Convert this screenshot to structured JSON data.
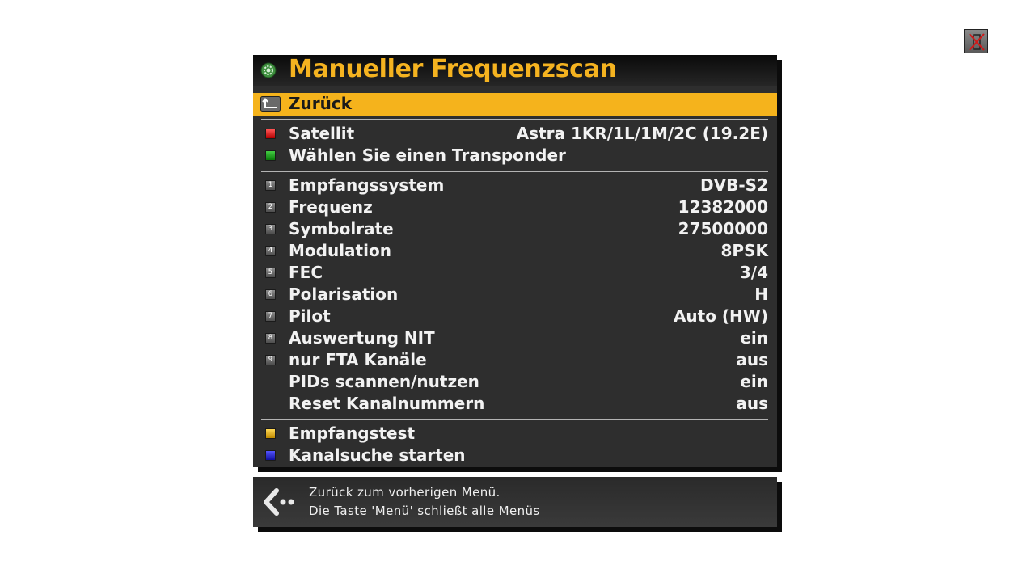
{
  "window": {
    "close_icon": "close-x-icon"
  },
  "menu": {
    "title": "Manueller Frequenzscan",
    "title_icon": "gear-icon",
    "title_color": "#f5b320",
    "highlight_color": "#f5b31c",
    "back": {
      "label": "Zurück",
      "icon": "back-arrow-icon",
      "selected": true
    },
    "section1": [
      {
        "key": "red",
        "label": "Satellit",
        "value": "Astra 1KR/1L/1M/2C (19.2E)"
      },
      {
        "key": "green",
        "label": "Wählen Sie einen Transponder",
        "value": ""
      }
    ],
    "section2": [
      {
        "key": "1",
        "label": "Empfangssystem",
        "value": "DVB-S2"
      },
      {
        "key": "2",
        "label": "Frequenz",
        "value": "12382000"
      },
      {
        "key": "3",
        "label": "Symbolrate",
        "value": "27500000"
      },
      {
        "key": "4",
        "label": "Modulation",
        "value": "8PSK"
      },
      {
        "key": "5",
        "label": "FEC",
        "value": "3/4"
      },
      {
        "key": "6",
        "label": "Polarisation",
        "value": "H"
      },
      {
        "key": "7",
        "label": "Pilot",
        "value": "Auto (HW)"
      },
      {
        "key": "8",
        "label": "Auswertung NIT",
        "value": "ein"
      },
      {
        "key": "9",
        "label": "nur FTA Kanäle",
        "value": "aus"
      },
      {
        "key": "",
        "label": "PIDs scannen/nutzen",
        "value": "ein"
      },
      {
        "key": "",
        "label": "Reset Kanalnummern",
        "value": "aus"
      }
    ],
    "section3": [
      {
        "key": "yellow",
        "label": "Empfangstest"
      },
      {
        "key": "blue",
        "label": "Kanalsuche starten"
      }
    ]
  },
  "hint": {
    "icon": "back-arrow-dots-icon",
    "line1": "Zurück zum vorherigen Menü.",
    "line2": "Die Taste 'Menü' schließt alle Menüs"
  }
}
